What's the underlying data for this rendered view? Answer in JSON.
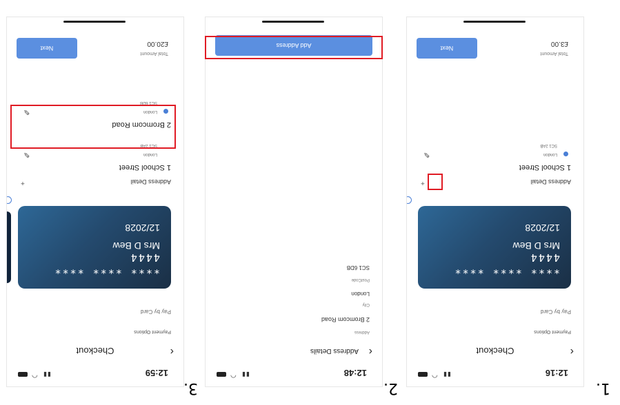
{
  "step_labels": [
    "1.",
    "2.",
    "3."
  ],
  "phones": [
    {
      "time": "12:16",
      "nav_title": "Checkout",
      "payment_options_label": "Payment Options",
      "pay_by_card_label": "Pay by Card",
      "card": {
        "number": "**** **** **** 4444",
        "holder": "Mrs D Bew",
        "expiry": "12/2028"
      },
      "address_section_label": "Address Detail",
      "add_icon": "+",
      "addresses": [
        {
          "street": "1 School Street",
          "city": "London",
          "postcode": "SC1 2AB"
        }
      ],
      "total_label": "Total Amount",
      "total_value": "£3.00",
      "next_label": "Next"
    },
    {
      "time": "12:48",
      "nav_title": "Address Details",
      "form": [
        {
          "label": "Address",
          "value": "2 Bromcom Road"
        },
        {
          "label": "City",
          "value": "London"
        },
        {
          "label": "PostCode",
          "value": "SC1 6DB"
        }
      ],
      "add_address_label": "Add Address"
    },
    {
      "time": "12:59",
      "nav_title": "Checkout",
      "payment_options_label": "Payment Options",
      "pay_by_card_label": "Pay by Card",
      "card": {
        "number": "**** **** **** 4444",
        "holder": "Mrs D Bew",
        "expiry": "12/2028"
      },
      "address_section_label": "Address Detail",
      "add_icon": "+",
      "addresses": [
        {
          "street": "1 School Street",
          "city": "London",
          "postcode": "SC1 2AB"
        },
        {
          "street": "2 Bromcom Road",
          "city": "London",
          "postcode": "SC1 6DB"
        }
      ],
      "total_label": "Total Amount",
      "total_value": "£20.00",
      "next_label": "Next"
    }
  ],
  "colors": {
    "highlight": "#e01b24",
    "accent": "#5b8fe0",
    "card_dark": "#1a2f45"
  }
}
